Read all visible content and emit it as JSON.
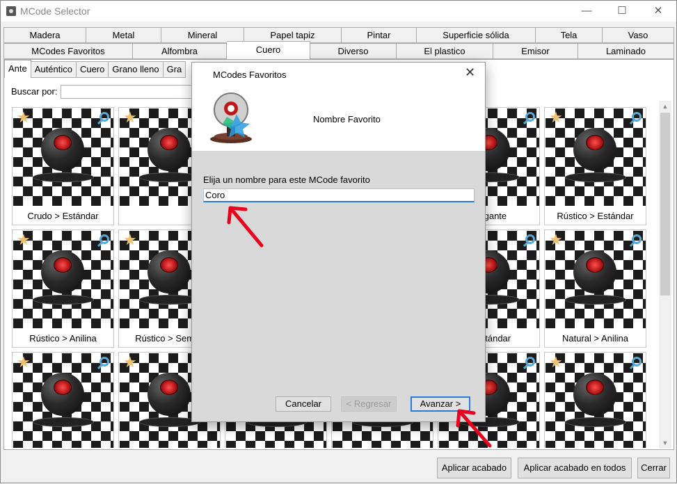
{
  "window": {
    "title": "MCode Selector",
    "icon": "mcode-app-icon"
  },
  "tabs_row1": [
    "Madera",
    "Metal",
    "Mineral",
    "Papel tapiz",
    "Pintar",
    "Superficie sólida",
    "Tela",
    "Vaso"
  ],
  "tabs_row2": [
    "MCodes Favoritos",
    "Alfombra",
    "Cuero",
    "Diverso",
    "El plastico",
    "Emisor",
    "Laminado"
  ],
  "tabs_row2_selected": "Cuero",
  "subtabs": [
    "Ante",
    "Auténtico",
    "Cuero",
    "Grano lleno",
    "Gra"
  ],
  "subtabs_selected": "Ante",
  "search": {
    "label": "Buscar por:",
    "value": ""
  },
  "cards": [
    {
      "label": "Crudo > Estándar"
    },
    {
      "label": ""
    },
    {
      "label": ""
    },
    {
      "label": ""
    },
    {
      "label": "Elegante"
    },
    {
      "label": "Rústico > Estándar"
    },
    {
      "label": "Rústico > Anilina"
    },
    {
      "label": "Rústico > Semi a"
    },
    {
      "label": ""
    },
    {
      "label": ""
    },
    {
      "label": "> Estándar"
    },
    {
      "label": "Natural > Anilina"
    },
    {
      "label": ""
    },
    {
      "label": ""
    },
    {
      "label": ""
    },
    {
      "label": ""
    },
    {
      "label": ""
    },
    {
      "label": ""
    }
  ],
  "footer": {
    "apply": "Aplicar acabado",
    "apply_all": "Aplicar acabado en todos",
    "close": "Cerrar"
  },
  "dialog": {
    "title": "MCodes Favoritos",
    "heading": "Nombre Favorito",
    "prompt": "Elija un nombre para este MCode favorito",
    "name_value": "Coro",
    "cancel": "Cancelar",
    "back": "< Regresar",
    "next": "Avanzar >"
  },
  "colors": {
    "accent": "#2a7ad5",
    "star": "#f0c070",
    "magnifier": "#5aa8d8",
    "annotation_arrow": "#e8001c"
  }
}
